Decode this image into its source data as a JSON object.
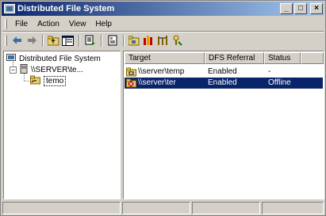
{
  "window": {
    "title": "Distributed File System"
  },
  "title_buttons": {
    "minimize": "_",
    "maximize": "□",
    "close": "×"
  },
  "menu": [
    "File",
    "Action",
    "View",
    "Help"
  ],
  "toolbar": {
    "icons": [
      "back-icon",
      "forward-icon",
      "up-folder-icon",
      "show-hide-tree-icon",
      "export-list-icon",
      "properties-icon",
      "new-root-icon",
      "new-link-icon",
      "replication-icon",
      "check-status-icon"
    ]
  },
  "tree": {
    "root_label": "Distributed File System",
    "server_label": "\\\\SERVER\\te...",
    "child_label": "temo"
  },
  "list": {
    "columns": [
      "Target",
      "DFS Referral",
      "Status"
    ],
    "rows": [
      {
        "target": "\\\\server\\temp",
        "referral": "Enabled",
        "status": "-",
        "icon": "folder-share-icon",
        "selected": false
      },
      {
        "target": "\\\\server\\ter",
        "referral": "Enabled",
        "status": "Offline",
        "icon": "folder-error-icon",
        "selected": true
      }
    ]
  },
  "colors": {
    "titlebar": "#0a246a",
    "face": "#d4d0c8",
    "selection": "#0a246a"
  }
}
